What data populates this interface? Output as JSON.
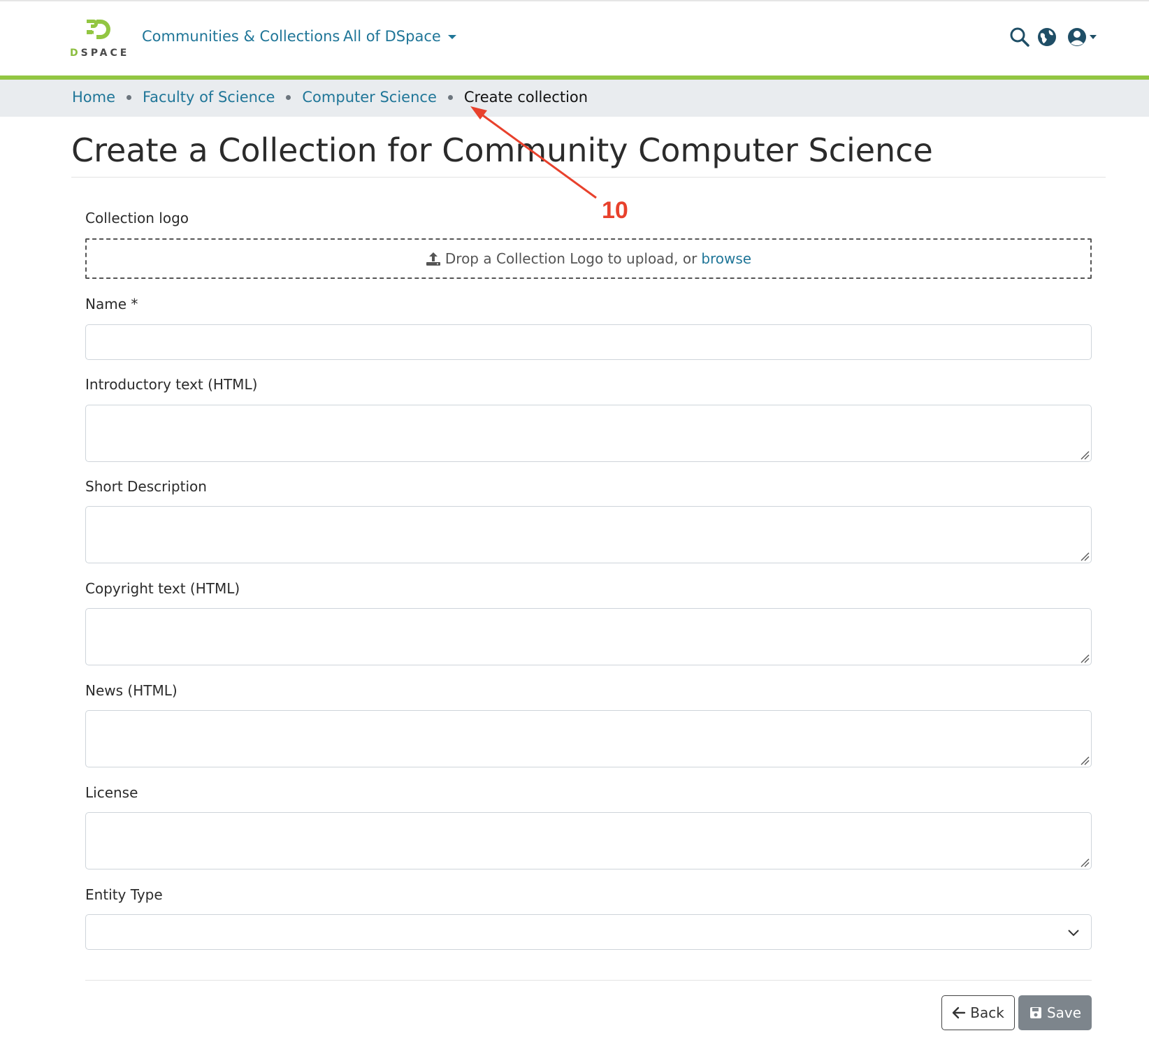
{
  "header": {
    "logo_text": "DSPACE",
    "nav": [
      {
        "label": "Communities & Collections"
      },
      {
        "label": "All of DSpace"
      }
    ],
    "icons": [
      "search-icon",
      "globe-icon",
      "user-circle-icon"
    ]
  },
  "breadcrumb": {
    "items": [
      "Home",
      "Faculty of Science",
      "Computer Science"
    ],
    "active": "Create collection"
  },
  "page": {
    "title": "Create a Collection for Community Computer Science"
  },
  "form": {
    "logo_label": "Collection logo",
    "dropzone_text": "Drop a Collection Logo to upload, or",
    "dropzone_link": "browse",
    "name_label": "Name *",
    "name_value": "",
    "intro_label": "Introductory text (HTML)",
    "short_desc_label": "Short Description",
    "copyright_label": "Copyright text (HTML)",
    "news_label": "News (HTML)",
    "license_label": "License",
    "entity_type_label": "Entity Type",
    "entity_type_value": ""
  },
  "buttons": {
    "back": "Back",
    "save": "Save"
  },
  "annotation": {
    "label": "10",
    "color": "#e8412c"
  },
  "colors": {
    "link": "#207698",
    "brand_green": "#92c642",
    "breadcrumb_bg": "#e9ecef",
    "save_button": "#7d858c"
  }
}
